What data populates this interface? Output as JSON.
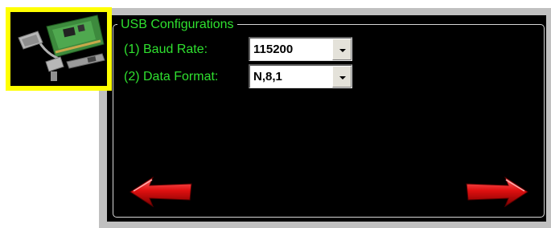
{
  "device_image_icon": "usb-serial-card-icon",
  "group": {
    "title": "USB Configurations"
  },
  "settings": [
    {
      "label": "(1) Baud Rate:",
      "value": "115200"
    },
    {
      "label": "(2) Data Format:",
      "value": "N,8,1"
    }
  ],
  "navigation": {
    "back_icon": "left-arrow-icon",
    "next_icon": "right-arrow-icon"
  },
  "colors": {
    "label_text": "#2fe02f",
    "screen_bg": "#000000",
    "frame_bg": "#c0c0c0",
    "highlight_border": "#ffff00",
    "arrow_red": "#e01010"
  }
}
